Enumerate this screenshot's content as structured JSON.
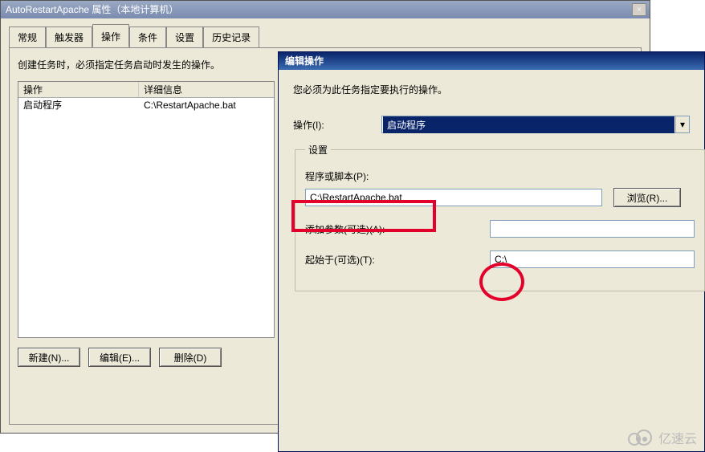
{
  "back_dialog": {
    "title": "AutoRestartApache 属性（本地计算机）",
    "tabs": [
      "常规",
      "触发器",
      "操作",
      "条件",
      "设置",
      "历史记录"
    ],
    "active_tab_index": 2,
    "instruction": "创建任务时，必须指定任务启动时发生的操作。",
    "table": {
      "columns": [
        "操作",
        "详细信息"
      ],
      "rows": [
        {
          "action": "启动程序",
          "details": "C:\\RestartApache.bat"
        }
      ]
    },
    "buttons": {
      "new": "新建(N)...",
      "edit": "编辑(E)...",
      "delete": "删除(D)"
    }
  },
  "front_dialog": {
    "title": "编辑操作",
    "instruction": "您必须为此任务指定要执行的操作。",
    "action_label": "操作(I):",
    "action_value": "启动程序",
    "settings_legend": "设置",
    "script_label": "程序或脚本(P):",
    "script_value": "C:\\RestartApache.bat",
    "browse_button": "浏览(R)...",
    "args_label": "添加参数(可选)(A):",
    "args_value": "",
    "startin_label": "起始于(可选)(T):",
    "startin_value": "C:\\"
  },
  "watermark": "亿速云"
}
